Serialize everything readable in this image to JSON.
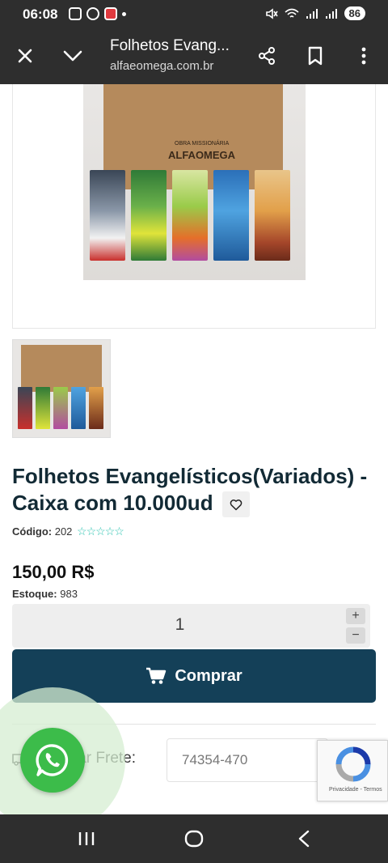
{
  "status_bar": {
    "time": "06:08",
    "battery": "86"
  },
  "browser": {
    "page_title": "Folhetos Evang...",
    "url": "alfaeomega.com.br"
  },
  "main_image": {
    "box_label": "OBRA MISSIONÁRIA",
    "box_brand": "ALFAOMEGA"
  },
  "product": {
    "title": "Folhetos Evangelísticos(Variados) - Caixa com 10.000ud",
    "code_label": "Código:",
    "code_value": "202",
    "rating_stars": 0,
    "price": "150,00 R$",
    "stock_label": "Estoque:",
    "stock_value": "983",
    "quantity": "1",
    "qty_plus": "+",
    "qty_minus": "−",
    "buy_label": "Comprar"
  },
  "shipping": {
    "label": "lar Frete:",
    "cep_value": "74354-470"
  },
  "recaptcha": {
    "footer": "Privacidade - Termos"
  },
  "colors": {
    "primary": "#144058",
    "whatsapp": "#3cbc4a",
    "stars": "#2fc4b2",
    "system_bar": "#2e2e2e"
  }
}
